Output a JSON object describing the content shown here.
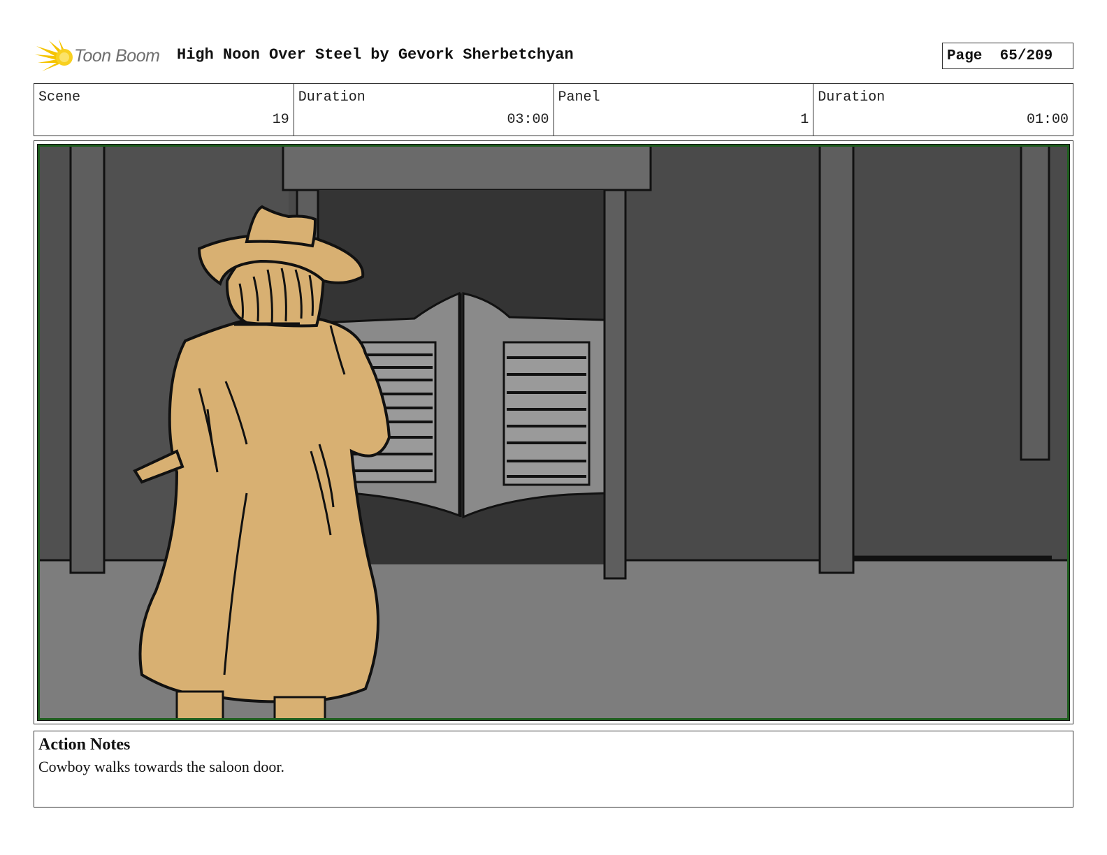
{
  "header": {
    "logo_text": "Toon Boom",
    "logo_icon": "starburst-logo-icon",
    "title": "High Noon Over Steel by Gevork Sherbetchyan",
    "page_label": "Page",
    "page_value": "65/209"
  },
  "info": {
    "scene_label": "Scene",
    "scene_value": "19",
    "scene_duration_label": "Duration",
    "scene_duration_value": "03:00",
    "panel_label": "Panel",
    "panel_value": "1",
    "panel_duration_label": "Duration",
    "panel_duration_value": "01:00"
  },
  "panel_image": {
    "subject": "storyboard-drawing-cowboy-saloon",
    "colors": {
      "border": "#1f5e1f",
      "wall_dark": "#4a4a4a",
      "wall_mid": "#5e5e5e",
      "floor": "#7d7d7d",
      "doorway": "#333333",
      "door": "#8a8a8a",
      "coat": "#d8b072"
    }
  },
  "notes": {
    "title": "Action Notes",
    "text": "Cowboy walks towards the saloon door."
  }
}
